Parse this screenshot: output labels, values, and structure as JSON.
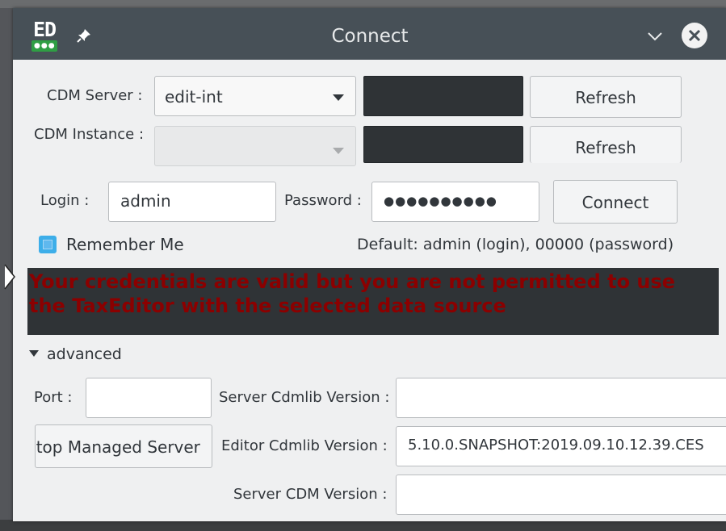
{
  "window": {
    "title": "Connect",
    "logo_text": "ED"
  },
  "server": {
    "cdm_server_label": "CDM Server :",
    "cdm_server_value": "edit-int",
    "cdm_instance_label": "CDM Instance :",
    "cdm_instance_value": "",
    "refresh_label_1": "Refresh",
    "refresh_label_2": "Refresh"
  },
  "credentials": {
    "login_label": "Login :",
    "login_value": "admin",
    "password_label": "Password :",
    "password_value": "●●●●●●●●●●",
    "connect_label": "Connect",
    "remember_me_label": "Remember Me",
    "remember_me_checked": true,
    "default_hint": "Default: admin (login), 00000 (password)"
  },
  "message": {
    "text": "Your credentials are valid but you are not permitted to use the TaxEditor with the selected data source",
    "color": "#8b0000"
  },
  "advanced": {
    "toggle_label": "advanced",
    "port_label": "Port :",
    "port_value": "",
    "server_cdmlib_version_label": "Server Cdmlib Version :",
    "server_cdmlib_version_value": "",
    "stop_managed_server_label": "Stop Managed Server",
    "editor_cdmlib_version_label": "Editor Cdmlib Version :",
    "editor_cdmlib_version_value": "5.10.0.SNAPSHOT:2019.09.10.12.39.CES",
    "server_cdm_version_label": "Server CDM Version :",
    "server_cdm_version_value": ""
  },
  "colors": {
    "titlebar": "#475057",
    "accent": "#3daee9",
    "window_bg": "#eff0f1"
  }
}
